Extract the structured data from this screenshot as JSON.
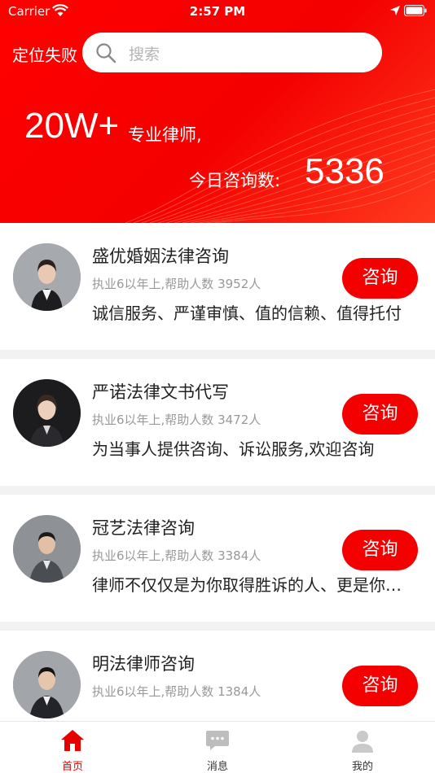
{
  "status_bar": {
    "carrier": "Carrier",
    "time": "2:57 PM"
  },
  "header": {
    "location": "定位失败",
    "search_placeholder": "搜索",
    "headline_big": "20W+",
    "headline_small": "专业律师,",
    "consult_label": "今日咨询数:",
    "consult_count": "5336"
  },
  "lawyers": [
    {
      "name": "盛优婚姻法律咨询",
      "meta": "执业6以年上,帮助人数 3952人",
      "desc": "诚信服务、严谨审慎、值的信赖、值得托付",
      "button": "咨询"
    },
    {
      "name": "严诺法律文书代写",
      "meta": "执业6以年上,帮助人数 3472人",
      "desc": "为当事人提供咨询、诉讼服务,欢迎咨询",
      "button": "咨询"
    },
    {
      "name": "冠艺法律咨询",
      "meta": "执业6以年上,帮助人数 3384人",
      "desc": "律师不仅仅是为你取得胜诉的人、更是你的朋友",
      "button": "咨询"
    },
    {
      "name": "明法律师咨询",
      "meta": "执业6以年上,帮助人数 1384人",
      "desc": "",
      "button": "咨询"
    }
  ],
  "tabbar": {
    "tabs": [
      {
        "label": "首页",
        "icon": "home-icon",
        "active": true
      },
      {
        "label": "消息",
        "icon": "message-icon",
        "active": false
      },
      {
        "label": "我的",
        "icon": "user-icon",
        "active": false
      }
    ]
  },
  "colors": {
    "brand": "#f40000",
    "active_tab": "#e60000"
  }
}
